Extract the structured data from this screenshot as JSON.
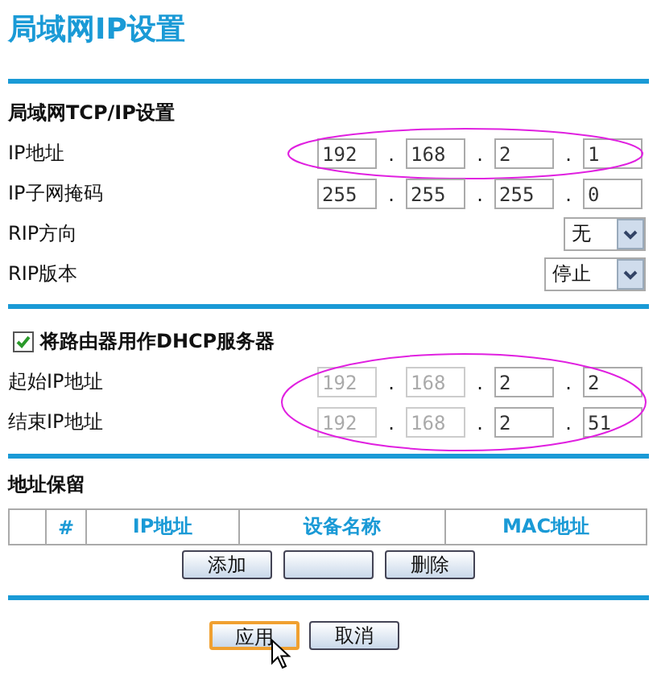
{
  "title": "局域网IP设置",
  "lan": {
    "heading": "局域网TCP/IP设置",
    "rows": [
      {
        "kind": "ip",
        "label": "IP地址",
        "highlighted": true,
        "octets": [
          {
            "value": "192",
            "disabled": false
          },
          {
            "dot": ".",
            "value": "168",
            "disabled": false
          },
          {
            "dot": ".",
            "value": "2",
            "disabled": false
          },
          {
            "dot": ".",
            "value": "1",
            "disabled": false
          }
        ]
      },
      {
        "kind": "ip",
        "label": "IP子网掩码",
        "highlighted": false,
        "octets": [
          {
            "value": "255",
            "disabled": false
          },
          {
            "dot": ".",
            "value": "255",
            "disabled": false
          },
          {
            "dot": ".",
            "value": "255",
            "disabled": false
          },
          {
            "dot": ".",
            "value": "0",
            "disabled": false
          }
        ]
      },
      {
        "kind": "select",
        "label": "RIP方向",
        "value": "无"
      },
      {
        "kind": "select",
        "label": "RIP版本",
        "value": "停止"
      }
    ]
  },
  "dhcp": {
    "label": "将路由器用作DHCP服务器",
    "checked": true,
    "highlighted": true,
    "rows": [
      {
        "kind": "ip",
        "label": "起始IP地址",
        "octets": [
          {
            "value": "192",
            "disabled": true
          },
          {
            "dot": ".",
            "value": "168",
            "disabled": true
          },
          {
            "dot": ".",
            "value": "2",
            "disabled": false
          },
          {
            "dot": ".",
            "value": "2",
            "disabled": false
          }
        ]
      },
      {
        "kind": "ip",
        "label": "结束IP地址",
        "octets": [
          {
            "value": "192",
            "disabled": true
          },
          {
            "dot": ".",
            "value": "168",
            "disabled": true
          },
          {
            "dot": ".",
            "value": "2",
            "disabled": false
          },
          {
            "dot": ".",
            "value": "51",
            "disabled": false
          }
        ]
      }
    ]
  },
  "reservation": {
    "heading": "地址保留",
    "columns": [
      "#",
      "IP地址",
      "设备名称",
      "MAC地址"
    ],
    "buttons": [
      {
        "kind": "labeled",
        "label": "添加"
      },
      {
        "kind": "blank"
      },
      {
        "kind": "labeled",
        "label": "删除"
      }
    ]
  },
  "actions": [
    {
      "label": "应用",
      "focused": true
    },
    {
      "label": "取消",
      "focused": false
    }
  ]
}
